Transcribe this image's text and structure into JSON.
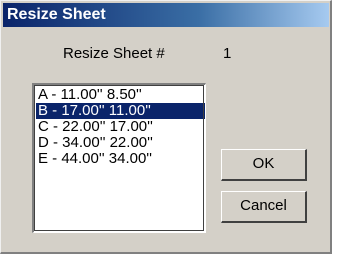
{
  "window": {
    "title": "Resize Sheet"
  },
  "sheet": {
    "label": "Resize Sheet #",
    "value": "1"
  },
  "sizes": {
    "items": [
      "A - 11.00'' 8.50''",
      "B - 17.00'' 11.00''",
      "C - 22.00'' 17.00''",
      "D - 34.00'' 22.00''",
      "E - 44.00'' 34.00''"
    ],
    "selected_index": 1
  },
  "buttons": {
    "ok_label": "OK",
    "cancel_label": "Cancel"
  },
  "colors": {
    "dialog_face": "#d4d0c8",
    "title_bar": "#0a246a",
    "selection": "#0a246a"
  }
}
